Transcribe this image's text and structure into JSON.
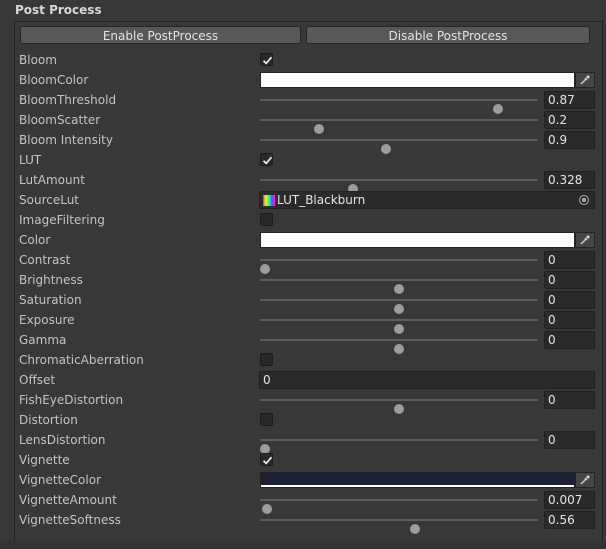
{
  "header": {
    "title": "Post Process"
  },
  "buttons": {
    "enable": "Enable PostProcess",
    "disable": "Disable PostProcess"
  },
  "colors": {
    "bloom_color": "#ffffff",
    "color": "#ffffff",
    "vignette_color": "#1e2036"
  },
  "rows": {
    "bloom": {
      "label": "Bloom",
      "checked": true
    },
    "bloom_color": {
      "label": "BloomColor"
    },
    "bloom_threshold": {
      "label": "BloomThreshold",
      "value": "0.87",
      "fraction": 0.87
    },
    "bloom_scatter": {
      "label": "BloomScatter",
      "value": "0.2",
      "fraction": 0.2
    },
    "bloom_intensity": {
      "label": "Bloom Intensity",
      "value": "0.9",
      "fraction": 0.45
    },
    "lut": {
      "label": "LUT",
      "checked": true
    },
    "lut_amount": {
      "label": "LutAmount",
      "value": "0.328",
      "fraction": 0.328
    },
    "source_lut": {
      "label": "SourceLut",
      "value": "LUT_Blackburn",
      "icon": "lut-texture-icon"
    },
    "image_filtering": {
      "label": "ImageFiltering",
      "checked": false
    },
    "color": {
      "label": "Color"
    },
    "contrast": {
      "label": "Contrast",
      "value": "0",
      "fraction": 0.0
    },
    "brightness": {
      "label": "Brightness",
      "value": "0",
      "fraction": 0.5
    },
    "saturation": {
      "label": "Saturation",
      "value": "0",
      "fraction": 0.5
    },
    "exposure": {
      "label": "Exposure",
      "value": "0",
      "fraction": 0.5
    },
    "gamma": {
      "label": "Gamma",
      "value": "0",
      "fraction": 0.5
    },
    "chromatic_aberration": {
      "label": "ChromaticAberration",
      "checked": false
    },
    "offset": {
      "label": "Offset",
      "value": "0"
    },
    "fisheye_distortion": {
      "label": "FishEyeDistortion",
      "value": "0",
      "fraction": 0.5
    },
    "distortion": {
      "label": "Distortion",
      "checked": false
    },
    "lens_distortion": {
      "label": "LensDistortion",
      "value": "0",
      "fraction": 0.0
    },
    "vignette": {
      "label": "Vignette",
      "checked": true
    },
    "vignette_color": {
      "label": "VignetteColor"
    },
    "vignette_amount": {
      "label": "VignetteAmount",
      "value": "0.007",
      "fraction": 0.007
    },
    "vignette_softness": {
      "label": "VignetteSoftness",
      "value": "0.56",
      "fraction": 0.56
    }
  }
}
